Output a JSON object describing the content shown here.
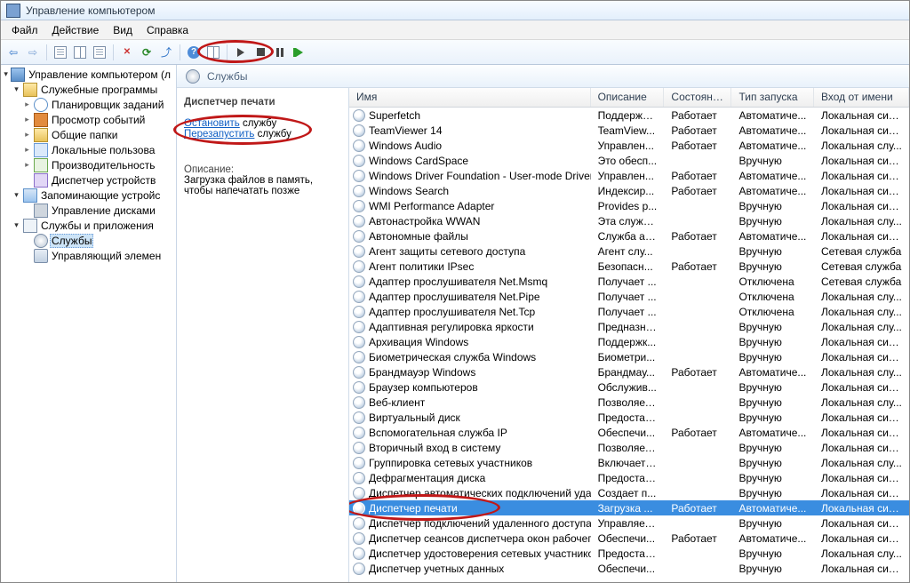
{
  "window": {
    "title": "Управление компьютером"
  },
  "menu": {
    "file": "Файл",
    "action": "Действие",
    "view": "Вид",
    "help": "Справка"
  },
  "tree": {
    "root": "Управление компьютером (л",
    "system_tools": "Служебные программы",
    "task_scheduler": "Планировщик заданий",
    "event_viewer": "Просмотр событий",
    "shared_folders": "Общие папки",
    "local_users": "Локальные пользова",
    "performance": "Производительность",
    "device_manager": "Диспетчер устройств",
    "storage": "Запоминающие устройс",
    "disk_mgmt": "Управление дисками",
    "services_apps": "Службы и приложения",
    "services": "Службы",
    "wmi": "Управляющий элемен"
  },
  "content_header": "Службы",
  "detail": {
    "title": "Диспетчер печати",
    "stop_link_a": "Остановить",
    "stop_link_b": " службу",
    "restart_link_a": "Перезапустить",
    "restart_link_b": " службу",
    "desc_label": "Описание:",
    "desc_text": "Загрузка файлов в память, чтобы напечатать позже"
  },
  "columns": {
    "name": "Имя",
    "desc": "Описание",
    "state": "Состояние",
    "start": "Тип запуска",
    "logon": "Вход от имени"
  },
  "selected_service": "Диспетчер печати",
  "services": [
    {
      "n": "Superfetch",
      "d": "Поддержи...",
      "s": "Работает",
      "t": "Автоматиче...",
      "l": "Локальная сис..."
    },
    {
      "n": "TeamViewer 14",
      "d": "TeamView...",
      "s": "Работает",
      "t": "Автоматиче...",
      "l": "Локальная сис..."
    },
    {
      "n": "Windows Audio",
      "d": "Управлен...",
      "s": "Работает",
      "t": "Автоматиче...",
      "l": "Локальная слу..."
    },
    {
      "n": "Windows CardSpace",
      "d": "Это обесп...",
      "s": "",
      "t": "Вручную",
      "l": "Локальная сис..."
    },
    {
      "n": "Windows Driver Foundation - User-mode Driver Fra...",
      "d": "Управлен...",
      "s": "Работает",
      "t": "Автоматиче...",
      "l": "Локальная сис..."
    },
    {
      "n": "Windows Search",
      "d": "Индексир...",
      "s": "Работает",
      "t": "Автоматиче...",
      "l": "Локальная сис..."
    },
    {
      "n": "WMI Performance Adapter",
      "d": "Provides p...",
      "s": "",
      "t": "Вручную",
      "l": "Локальная сис..."
    },
    {
      "n": "Автонастройка WWAN",
      "d": "Эта служб...",
      "s": "",
      "t": "Вручную",
      "l": "Локальная слу..."
    },
    {
      "n": "Автономные файлы",
      "d": "Служба ав...",
      "s": "Работает",
      "t": "Автоматиче...",
      "l": "Локальная сис..."
    },
    {
      "n": "Агент защиты сетевого доступа",
      "d": "Агент слу...",
      "s": "",
      "t": "Вручную",
      "l": "Сетевая служба"
    },
    {
      "n": "Агент политики IPsec",
      "d": "Безопасн...",
      "s": "Работает",
      "t": "Вручную",
      "l": "Сетевая служба"
    },
    {
      "n": "Адаптер прослушивателя Net.Msmq",
      "d": "Получает ...",
      "s": "",
      "t": "Отключена",
      "l": "Сетевая служба"
    },
    {
      "n": "Адаптер прослушивателя Net.Pipe",
      "d": "Получает ...",
      "s": "",
      "t": "Отключена",
      "l": "Локальная слу..."
    },
    {
      "n": "Адаптер прослушивателя Net.Tcp",
      "d": "Получает ...",
      "s": "",
      "t": "Отключена",
      "l": "Локальная слу..."
    },
    {
      "n": "Адаптивная регулировка яркости",
      "d": "Предназна...",
      "s": "",
      "t": "Вручную",
      "l": "Локальная слу..."
    },
    {
      "n": "Архивация Windows",
      "d": "Поддержк...",
      "s": "",
      "t": "Вручную",
      "l": "Локальная сис..."
    },
    {
      "n": "Биометрическая служба Windows",
      "d": "Биометри...",
      "s": "",
      "t": "Вручную",
      "l": "Локальная сис..."
    },
    {
      "n": "Брандмауэр Windows",
      "d": "Брандмау...",
      "s": "Работает",
      "t": "Автоматиче...",
      "l": "Локальная слу..."
    },
    {
      "n": "Браузер компьютеров",
      "d": "Обслужив...",
      "s": "",
      "t": "Вручную",
      "l": "Локальная сис..."
    },
    {
      "n": "Веб-клиент",
      "d": "Позволяет...",
      "s": "",
      "t": "Вручную",
      "l": "Локальная слу..."
    },
    {
      "n": "Виртуальный диск",
      "d": "Предостав...",
      "s": "",
      "t": "Вручную",
      "l": "Локальная сис..."
    },
    {
      "n": "Вспомогательная служба IP",
      "d": "Обеспечи...",
      "s": "Работает",
      "t": "Автоматиче...",
      "l": "Локальная сис..."
    },
    {
      "n": "Вторичный вход в систему",
      "d": "Позволяет...",
      "s": "",
      "t": "Вручную",
      "l": "Локальная сис..."
    },
    {
      "n": "Группировка сетевых участников",
      "d": "Включает ...",
      "s": "",
      "t": "Вручную",
      "l": "Локальная слу..."
    },
    {
      "n": "Дефрагментация диска",
      "d": "Предостав...",
      "s": "",
      "t": "Вручную",
      "l": "Локальная сис..."
    },
    {
      "n": "Диспетчер автоматических подключений удален...",
      "d": "Создает п...",
      "s": "",
      "t": "Вручную",
      "l": "Локальная сис..."
    },
    {
      "n": "Диспетчер печати",
      "d": "Загрузка ...",
      "s": "Работает",
      "t": "Автоматиче...",
      "l": "Локальная сис..."
    },
    {
      "n": "Диспетчер подключений удаленного доступа",
      "d": "Управляет...",
      "s": "",
      "t": "Вручную",
      "l": "Локальная сис..."
    },
    {
      "n": "Диспетчер сеансов диспетчера окон рабочего с...",
      "d": "Обеспечи...",
      "s": "Работает",
      "t": "Автоматиче...",
      "l": "Локальная сис..."
    },
    {
      "n": "Диспетчер удостоверения сетевых участников",
      "d": "Предостав...",
      "s": "",
      "t": "Вручную",
      "l": "Локальная слу..."
    },
    {
      "n": "Диспетчер учетных данных",
      "d": "Обеспечи...",
      "s": "",
      "t": "Вручную",
      "l": "Локальная сис..."
    }
  ]
}
